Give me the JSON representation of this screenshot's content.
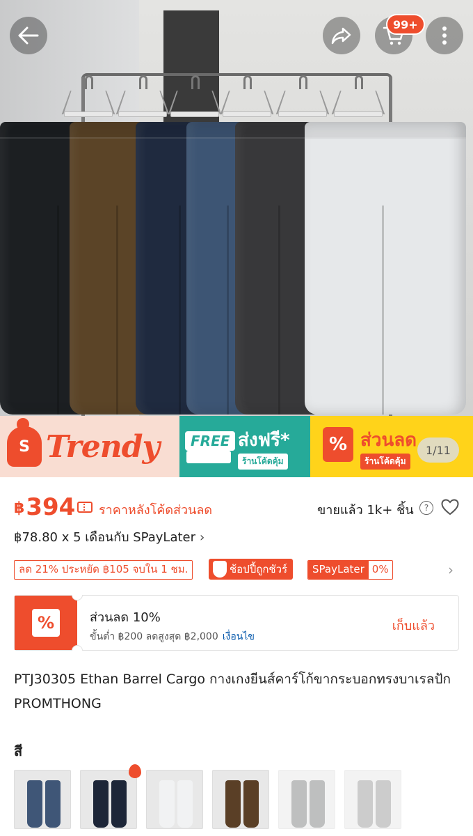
{
  "header": {
    "cart_badge": "99+",
    "icons": [
      "back-arrow-icon",
      "share-icon",
      "cart-icon",
      "more-icon"
    ]
  },
  "gallery": {
    "counter": "1/11",
    "pants_colors": [
      "#1c1f22",
      "#5b4427",
      "#1f2a3f",
      "#3d5574",
      "#38383a",
      "#e6e8ea"
    ]
  },
  "banner": {
    "trendy": "Trendy",
    "trendy_icon_letter": "S",
    "free_tag": "FREE",
    "free_big": "ส่งฟรี*",
    "free_small": "ร้านโค้ดคุ้ม",
    "disc_big": "ส่วนลด",
    "disc_small": "ร้านโค้ดคุ้ม",
    "disc_icon": "%"
  },
  "price": {
    "currency": "฿",
    "amount": "394",
    "after_code_text": "ราคาหลังโค้ดส่วนลด",
    "sold": "ขายแล้ว 1k+ ชิ้น",
    "paylater": "฿78.80 x 5 เดือนกับ SPayLater"
  },
  "tags": {
    "discount": "ลด 21% ประหยัด ฿105 จบใน 1 ชม.",
    "guarantee": "ช้อปปี้ถูกชัวร์",
    "spaylater": "SPayLater",
    "spaylater_rate": "0%"
  },
  "voucher": {
    "title": "ส่วนลด 10%",
    "condition": "ขั้นต่ำ ฿200 ลดสูงสุด ฿2,000",
    "terms_link": "เงื่อนไข",
    "claim": "เก็บแล้ว",
    "icon": "%"
  },
  "product": {
    "title": "PTJ30305 Ethan Barrel Cargo กางเกงยีนส์คาร์โก้ขากระบอกทรงบาเรลปัก PROMTHONG"
  },
  "variants": {
    "label": "สี",
    "swatches": [
      {
        "color": "#3f5677",
        "available": true
      },
      {
        "color": "#1d2638",
        "available": true,
        "hot": true
      },
      {
        "color": "#f1f2f3",
        "available": true
      },
      {
        "color": "#5a3f26",
        "available": true
      },
      {
        "color": "#7f8081",
        "available": false
      },
      {
        "color": "#9a9a9a",
        "available": false
      }
    ]
  }
}
